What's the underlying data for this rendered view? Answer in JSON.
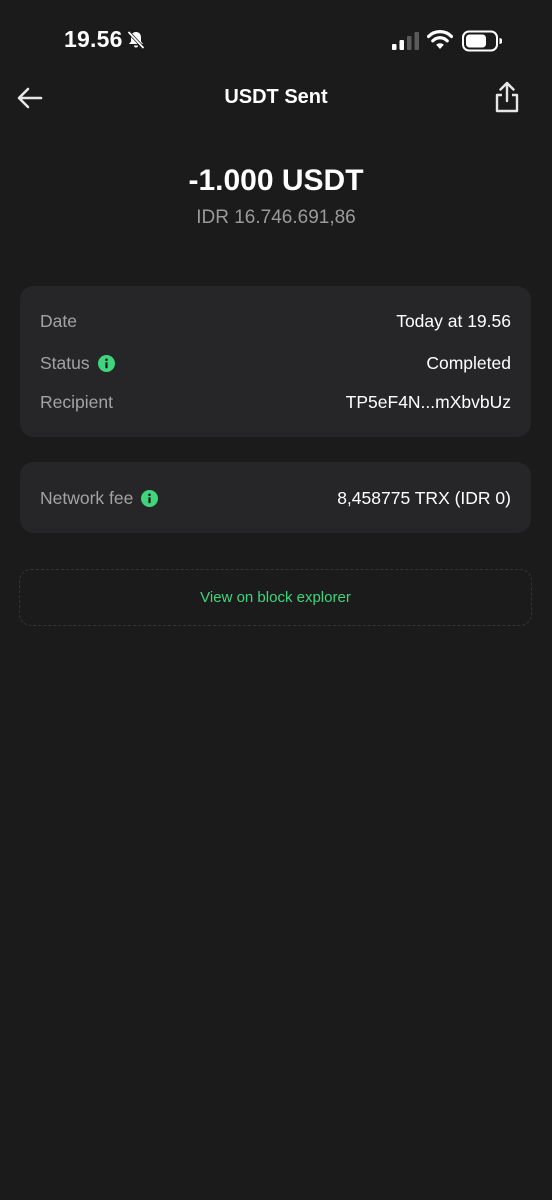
{
  "status_bar": {
    "time": "19.56",
    "icons": [
      "bell-muted-icon",
      "signal-icon",
      "wifi-icon",
      "battery-icon"
    ]
  },
  "header": {
    "title": "USDT Sent",
    "back_icon": "arrow-left-icon",
    "share_icon": "share-icon"
  },
  "amount": {
    "crypto": "-1.000 USDT",
    "fiat": "IDR 16.746.691,86"
  },
  "details": [
    {
      "label": "Date",
      "value": "Today at 19.56",
      "info": false
    },
    {
      "label": "Status",
      "value": "Completed",
      "info": true
    },
    {
      "label": "Recipient",
      "value": "TP5eF4N...mXbvbUz",
      "info": false
    }
  ],
  "fee": {
    "label": "Network fee",
    "value": "8,458775 TRX (IDR 0)",
    "info": true
  },
  "explorer_link": "View on block explorer",
  "colors": {
    "background": "#1b1b1b",
    "card": "#262628",
    "accent": "#3fd57d",
    "muted_text": "#a3a3a3"
  }
}
